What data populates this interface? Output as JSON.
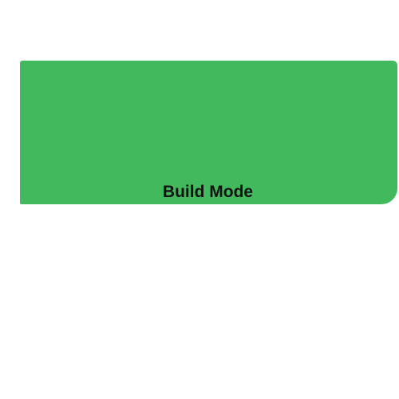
{
  "mode_button": {
    "label": "Build Mode",
    "color": "#43b95e"
  }
}
